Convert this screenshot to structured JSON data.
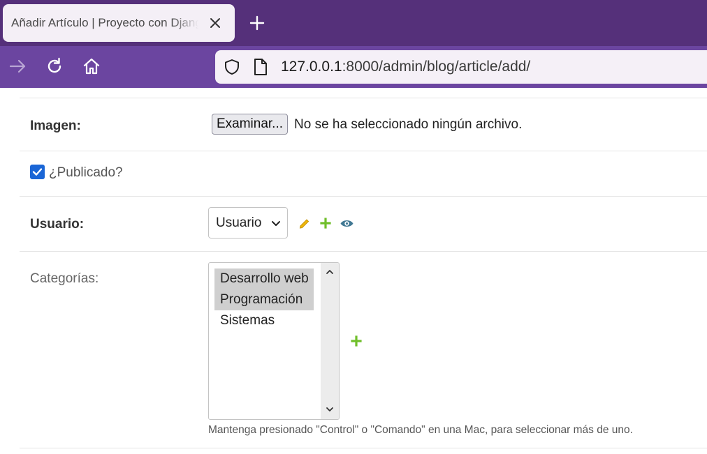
{
  "browser": {
    "tab_title": "Añadir Artículo | Proyecto con Django",
    "url_host": "127.0.0.1",
    "url_rest": ":8000/admin/blog/article/add/",
    "colors": {
      "tabbar": "#55307a",
      "navbar": "#6b45a0"
    }
  },
  "form": {
    "image": {
      "label": "Imagen:",
      "button": "Examinar...",
      "status": "No se ha seleccionado ningún archivo."
    },
    "published": {
      "label": "¿Publicado?",
      "checked": true
    },
    "user": {
      "label": "Usuario:",
      "selected": "Usuario",
      "icons": [
        "pencil-icon",
        "add-icon",
        "view-icon"
      ]
    },
    "categories": {
      "label": "Categorías:",
      "options": [
        {
          "label": "Desarrollo web",
          "selected": true
        },
        {
          "label": "Programación",
          "selected": true
        },
        {
          "label": "Sistemas",
          "selected": false
        }
      ],
      "help": "Mantenga presionado \"Control\" o \"Comando\" en una Mac, para seleccionar más de uno."
    }
  },
  "colors": {
    "add_green": "#70bf2b",
    "edit_yellow": "#efb80b",
    "view_blue": "#417893",
    "checkbox": "#1a66d6"
  }
}
